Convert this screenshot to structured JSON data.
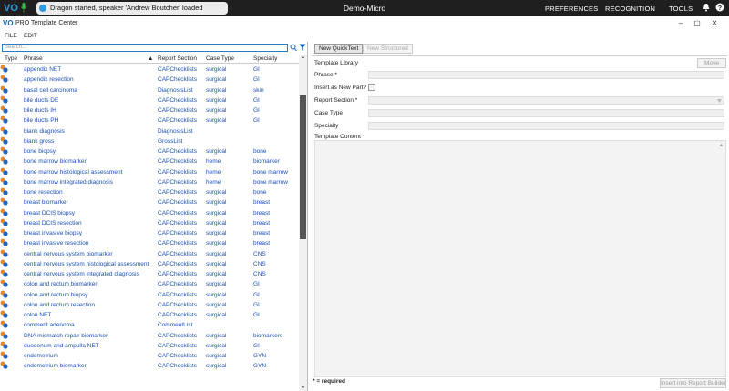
{
  "topbar": {
    "dragon_status": "Dragon started, speaker 'Andrew Boutcher' loaded",
    "app_title": "Demo-Micro",
    "menu": [
      "PREFERENCES",
      "RECOGNITION",
      "TOOLS"
    ],
    "logo": "VO"
  },
  "window": {
    "logo": "VO",
    "title": "PRO Template Center",
    "controls": [
      "–",
      "▢",
      "✕"
    ]
  },
  "menubar": [
    "FILE",
    "EDIT"
  ],
  "search": {
    "placeholder": "Search..."
  },
  "table": {
    "headers": [
      "Type",
      "Phrase",
      "Report Section",
      "Case Type",
      "Specialty"
    ],
    "sort_indicator": "▲",
    "rows": [
      {
        "phrase": "appendix NET",
        "section": "CAPChecklists",
        "case": "surgical",
        "spec": "GI"
      },
      {
        "phrase": "appendix resection",
        "section": "CAPChecklists",
        "case": "surgical",
        "spec": "GI"
      },
      {
        "phrase": "basal cell carcinoma",
        "section": "DiagnosisList",
        "case": "surgical",
        "spec": "skin"
      },
      {
        "phrase": "bile ducts DE",
        "section": "CAPChecklists",
        "case": "surgical",
        "spec": "GI"
      },
      {
        "phrase": "bile ducts IH",
        "section": "CAPChecklists",
        "case": "surgical",
        "spec": "GI"
      },
      {
        "phrase": "bile ducts PH",
        "section": "CAPChecklists",
        "case": "surgical",
        "spec": "GI"
      },
      {
        "phrase": "blank diagnosis",
        "section": "DiagnosisList",
        "case": "",
        "spec": ""
      },
      {
        "phrase": "blank gross",
        "section": "GrossList",
        "case": "",
        "spec": ""
      },
      {
        "phrase": "bone biopsy",
        "section": "CAPChecklists",
        "case": "surgical",
        "spec": "bone"
      },
      {
        "phrase": "bone marrow biomarker",
        "section": "CAPChecklists",
        "case": "heme",
        "spec": "biomarker"
      },
      {
        "phrase": "bone marrow histological assessment",
        "section": "CAPChecklists",
        "case": "heme",
        "spec": "bone marrow"
      },
      {
        "phrase": "bone marrow integrated diagnosis",
        "section": "CAPChecklists",
        "case": "heme",
        "spec": "bone marrow"
      },
      {
        "phrase": "bone resection",
        "section": "CAPChecklists",
        "case": "surgical",
        "spec": "bone"
      },
      {
        "phrase": "breast biomarker",
        "section": "CAPChecklists",
        "case": "surgical",
        "spec": "breast"
      },
      {
        "phrase": "breast DCIS biopsy",
        "section": "CAPChecklists",
        "case": "surgical",
        "spec": "breast"
      },
      {
        "phrase": "breast DCIS resection",
        "section": "CAPChecklists",
        "case": "surgical",
        "spec": "breast"
      },
      {
        "phrase": "breast invasive biopsy",
        "section": "CAPChecklists",
        "case": "surgical",
        "spec": "breast"
      },
      {
        "phrase": "breast invasive resection",
        "section": "CAPChecklists",
        "case": "surgical",
        "spec": "breast"
      },
      {
        "phrase": "central nervous system biomarker",
        "section": "CAPChecklists",
        "case": "surgical",
        "spec": "CNS"
      },
      {
        "phrase": "central nervous system histological assessment",
        "section": "CAPChecklists",
        "case": "surgical",
        "spec": "CNS"
      },
      {
        "phrase": "central nervous system integrated diagnosis",
        "section": "CAPChecklists",
        "case": "surgical",
        "spec": "CNS"
      },
      {
        "phrase": "colon and rectum biomarker",
        "section": "CAPChecklists",
        "case": "surgical",
        "spec": "GI"
      },
      {
        "phrase": "colon and rectum biopsy",
        "section": "CAPChecklists",
        "case": "surgical",
        "spec": "GI"
      },
      {
        "phrase": "colon and rectum resection",
        "section": "CAPChecklists",
        "case": "surgical",
        "spec": "GI"
      },
      {
        "phrase": "colon NET",
        "section": "CAPChecklists",
        "case": "surgical",
        "spec": "GI"
      },
      {
        "phrase": "comment adenoma",
        "section": "CommentList",
        "case": "",
        "spec": ""
      },
      {
        "phrase": "DNA mismatch repair biomarker",
        "section": "CAPChecklists",
        "case": "surgical",
        "spec": "biomarkers"
      },
      {
        "phrase": "duodenum and ampulla NET",
        "section": "CAPChecklists",
        "case": "surgical",
        "spec": "GI"
      },
      {
        "phrase": "endometrium",
        "section": "CAPChecklists",
        "case": "surgical",
        "spec": "GYN"
      },
      {
        "phrase": "endometrium biomarker",
        "section": "CAPChecklists",
        "case": "surgical",
        "spec": "GYN"
      }
    ]
  },
  "right": {
    "buttons": {
      "new_quicktext": "New QuickText",
      "new_structured": "New Structured",
      "move": "Move",
      "insert": "Insert into Report Builder"
    },
    "labels": {
      "library": "Template Library",
      "phrase": "Phrase *",
      "insert_new_part": "Insert as New Part?",
      "report_section": "Report Section *",
      "case_type": "Case Type",
      "specialty": "Specialty",
      "content": "Template Content *"
    },
    "required_note": "* = required"
  },
  "colors": {
    "accent": "#2f9be0",
    "link": "#1a4fb5",
    "topbar": "#1f1f1f"
  }
}
